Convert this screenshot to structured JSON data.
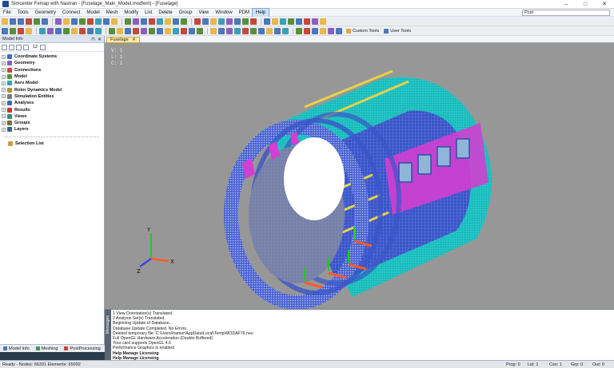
{
  "window": {
    "title": "Simcenter Femap with Nastran - [Fuselage_Main_Model.modfem] - [Fuselage]",
    "controls": [
      "–",
      "□",
      "✕"
    ]
  },
  "menubar": {
    "items": [
      "File",
      "Tools",
      "Geometry",
      "Connect",
      "Model",
      "Mesh",
      "Modify",
      "List",
      "Delete",
      "Group",
      "View",
      "Window",
      "PDM",
      "Help"
    ],
    "search_value": "Post"
  },
  "toolbar2": {
    "custom_tools": "Custom Tools",
    "user_tools": "User Tools"
  },
  "model_info": {
    "title": "Model Info",
    "pin": "⊓",
    "close": "✕",
    "count_label": "12",
    "tree": [
      {
        "label": "Coordinate Systems",
        "color": "#3a6fb8"
      },
      {
        "label": "Geometry",
        "color": "#8b5fbf"
      },
      {
        "label": "Connections",
        "color": "#c24a3a"
      },
      {
        "label": "Model",
        "color": "#5a8f3a"
      },
      {
        "label": "Aero Model",
        "color": "#3a9fb8"
      },
      {
        "label": "Rotor Dynamics Model",
        "color": "#b88a3a"
      },
      {
        "label": "Simulation Entities",
        "color": "#7a7a7a"
      },
      {
        "label": "Analyses",
        "color": "#3a6fb8"
      },
      {
        "label": "Results",
        "color": "#c23a3a"
      },
      {
        "label": "Views",
        "color": "#3a8f6f"
      },
      {
        "label": "Groups",
        "color": "#6f6f3a"
      },
      {
        "label": "Layers",
        "color": "#3a5f8f"
      }
    ],
    "selection_list": "Selection List",
    "tabs": [
      "Model Info",
      "Meshing",
      "PostProcessing"
    ]
  },
  "view": {
    "tab_label": "Fuselage",
    "info_lines": [
      "V: 1",
      "L: 1",
      "C: 1"
    ]
  },
  "messages": {
    "side_label": "Messages",
    "lines": [
      {
        "text": "1 View Orientation(s) Translated.",
        "bold": false
      },
      {
        "text": "2 Analysis Set(s) Translated.",
        "bold": false
      },
      {
        "text": "Beginning Update of Database...",
        "bold": false
      },
      {
        "text": "Database Update Completed. No Errors.",
        "bold": false
      },
      {
        "text": "Deleted temporary file: C:\\Users\\hamer\\AppData\\Local\\Temp\\MODAF76.neu",
        "bold": false
      },
      {
        "text": "Full OpenGL Hardware Acceleration (Double Buffered)",
        "bold": false
      },
      {
        "text": "Your card supports OpenGL 4.6",
        "bold": false
      },
      {
        "text": "Performance Graphics is enabled",
        "bold": false
      },
      {
        "text": "Help Manage Licensing",
        "bold": true
      },
      {
        "text": "Help Manage Licensing",
        "bold": true
      }
    ]
  },
  "status": {
    "left": "Ready - Nodes: 66331  Elements: 65092",
    "cells": [
      "Prop: 0",
      "Lid: 1",
      "Csn: 1",
      "Grp: 0",
      "Out: 0"
    ]
  },
  "colors": {
    "viewport_bg": "#979797",
    "mesh_blue": "#3a55c8",
    "skin_cyan": "#23c7c7",
    "panel_magenta": "#d23fd2",
    "stringer_yellow": "#e6d24a"
  }
}
